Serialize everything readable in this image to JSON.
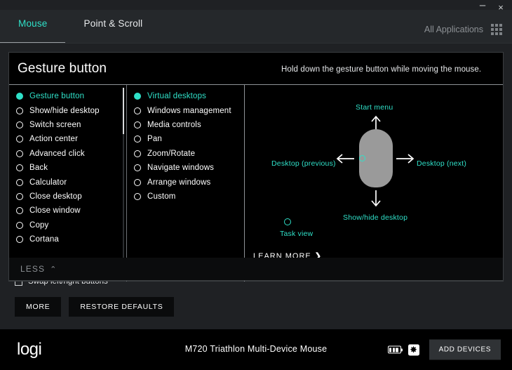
{
  "colors": {
    "accent": "#2fe0c8",
    "panel_bg": "#000000",
    "app_bg": "#1f2124",
    "tabbar_bg": "#25282b",
    "footer_bg": "#000000",
    "muted_text": "#8d9195"
  },
  "titlebar": {
    "minimize_label": "–",
    "close_label": "×"
  },
  "tabs": [
    {
      "label": "Mouse",
      "active": true
    },
    {
      "label": "Point & Scroll",
      "active": false
    }
  ],
  "header": {
    "all_applications_label": "All Applications",
    "grid_icon": "grid-apps-icon"
  },
  "panel": {
    "title": "Gesture button",
    "hint": "Hold down the gesture button while moving the mouse.",
    "less_label": "LESS",
    "less_chevron": "⌃"
  },
  "column_a": {
    "items": [
      {
        "label": "Gesture button",
        "selected": true
      },
      {
        "label": "Show/hide desktop",
        "selected": false
      },
      {
        "label": "Switch screen",
        "selected": false
      },
      {
        "label": "Action center",
        "selected": false
      },
      {
        "label": "Advanced click",
        "selected": false
      },
      {
        "label": "Back",
        "selected": false
      },
      {
        "label": "Calculator",
        "selected": false
      },
      {
        "label": "Close desktop",
        "selected": false
      },
      {
        "label": "Close window",
        "selected": false
      },
      {
        "label": "Copy",
        "selected": false
      },
      {
        "label": "Cortana",
        "selected": false
      }
    ]
  },
  "column_b": {
    "items": [
      {
        "label": "Virtual desktops",
        "selected": true
      },
      {
        "label": "Windows management",
        "selected": false
      },
      {
        "label": "Media controls",
        "selected": false
      },
      {
        "label": "Pan",
        "selected": false
      },
      {
        "label": "Zoom/Rotate",
        "selected": false
      },
      {
        "label": "Navigate windows",
        "selected": false
      },
      {
        "label": "Arrange windows",
        "selected": false
      },
      {
        "label": "Custom",
        "selected": false
      }
    ]
  },
  "diagram": {
    "up_label": "Start menu",
    "left_label": "Desktop (previous)",
    "right_label": "Desktop (next)",
    "down_label": "Show/hide desktop",
    "wheel_label": "Task view",
    "learn_more_label": "LEARN MORE",
    "learn_more_chevron": "❯"
  },
  "background": {
    "swap_buttons_label": "Swap left/right buttons"
  },
  "actions": {
    "more_label": "MORE",
    "restore_label": "RESTORE DEFAULTS"
  },
  "footer": {
    "brand": "logi",
    "device_name": "M720 Triathlon Multi-Device Mouse",
    "battery_icon": "battery-icon",
    "unifying_icon": "unifying-receiver-icon",
    "unifying_glyph": "✸",
    "add_devices_label": "ADD DEVICES"
  }
}
